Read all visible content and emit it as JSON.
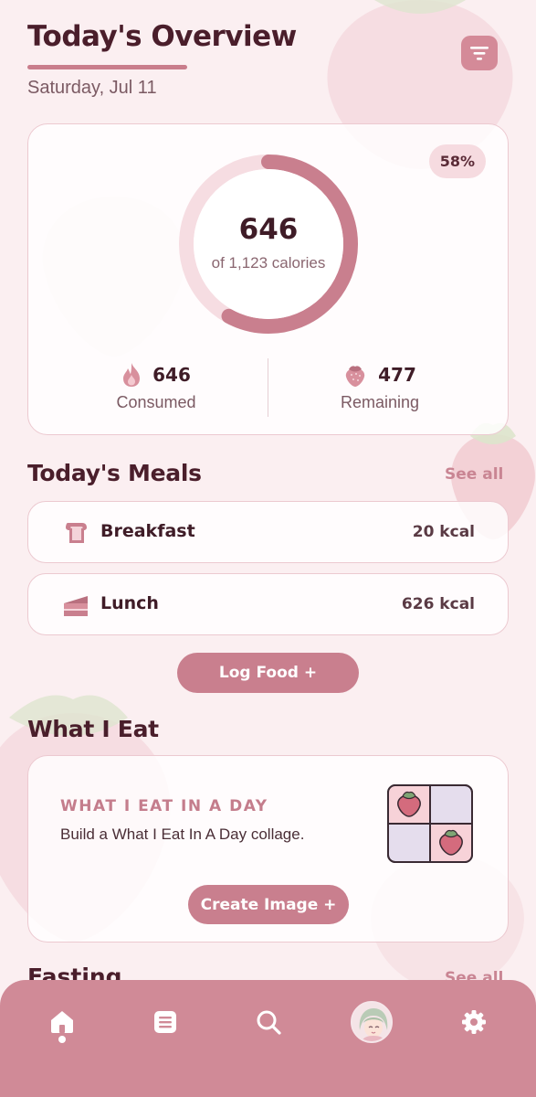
{
  "header": {
    "title": "Today's Overview",
    "date": "Saturday, Jul 11"
  },
  "calories": {
    "consumed_value": "646",
    "of_total": "of 1,123 calories",
    "percent_label": "58%",
    "progress_fraction": 0.58,
    "consumed_stat": "646",
    "consumed_label": "Consumed",
    "remaining_stat": "477",
    "remaining_label": "Remaining"
  },
  "meals": {
    "title": "Today's Meals",
    "see_all": "See all",
    "items": [
      {
        "name": "Breakfast",
        "kcal": "20 kcal",
        "icon": "toast-icon"
      },
      {
        "name": "Lunch",
        "kcal": "626 kcal",
        "icon": "cake-slice-icon"
      }
    ],
    "log_food_label": "Log Food +"
  },
  "what_i_eat": {
    "title": "What I Eat",
    "card_heading": "WHAT I EAT IN A DAY",
    "card_desc": "Build a What I Eat In A Day collage.",
    "create_label": "Create Image +"
  },
  "fasting": {
    "title": "Fasting",
    "see_all": "See all"
  },
  "nav": {
    "items": [
      "home-icon",
      "list-icon",
      "search-icon",
      "avatar",
      "gear-icon"
    ]
  },
  "colors": {
    "accent": "#c97f8e",
    "nav_bg": "#d08a97",
    "background": "#fbeff1",
    "text_dark": "#4a1e2b"
  }
}
